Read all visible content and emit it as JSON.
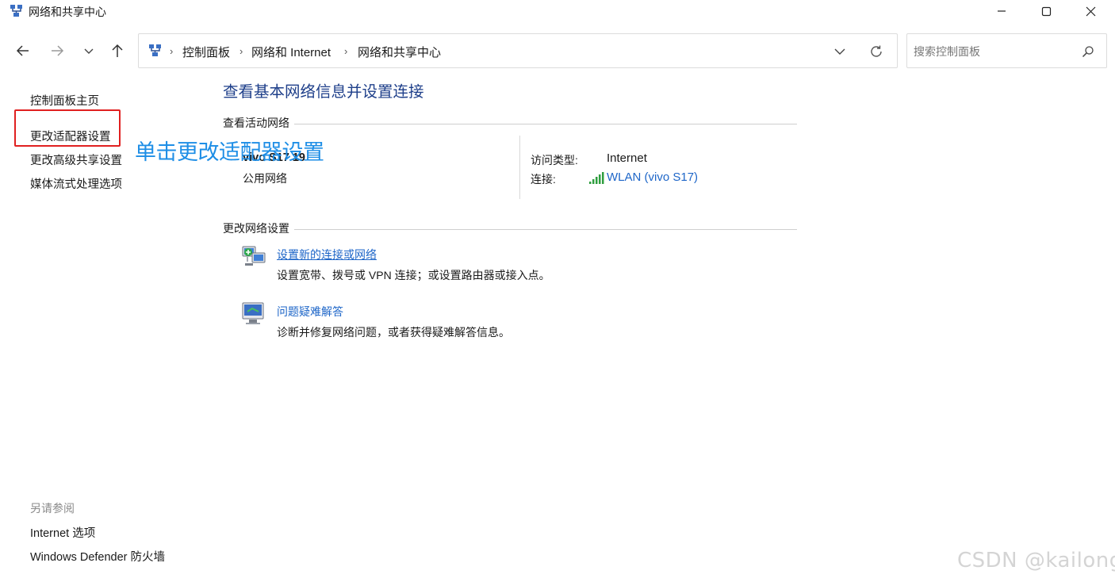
{
  "window": {
    "title": "网络和共享中心"
  },
  "address": {
    "breadcrumbs": [
      "控制面板",
      "网络和 Internet",
      "网络和共享中心"
    ],
    "separator": "›"
  },
  "search": {
    "placeholder": "搜索控制面板"
  },
  "sidebar": {
    "items": [
      {
        "label": "控制面板主页"
      },
      {
        "label": "更改适配器设置"
      },
      {
        "label": "更改高级共享设置"
      },
      {
        "label": "媒体流式处理选项"
      }
    ],
    "see_also_heading": "另请参阅",
    "see_also": [
      {
        "label": "Internet 选项"
      },
      {
        "label": "Windows Defender 防火墙"
      }
    ]
  },
  "annotation": {
    "text": "单击更改适配器设置",
    "color": "#1e8ee6",
    "highlight_color": "#e02020"
  },
  "main": {
    "title": "查看基本网络信息并设置连接",
    "active_section_label": "查看活动网络",
    "network": {
      "name": "vivo S17 19",
      "type": "公用网络",
      "access_label": "访问类型:",
      "access_value": "Internet",
      "connection_label": "连接:",
      "connection_value": "WLAN (vivo S17)"
    },
    "change_section_label": "更改网络设置",
    "tasks": [
      {
        "link": "设置新的连接或网络",
        "desc": "设置宽带、拨号或 VPN 连接；或设置路由器或接入点。",
        "icon": "network-setup-icon"
      },
      {
        "link": "问题疑难解答",
        "desc": "诊断并修复网络问题，或者获得疑难解答信息。",
        "icon": "troubleshoot-icon"
      }
    ]
  },
  "watermark": "CSDN @kailongf",
  "colors": {
    "link": "#1e66c8",
    "title": "#1e3f8a"
  }
}
